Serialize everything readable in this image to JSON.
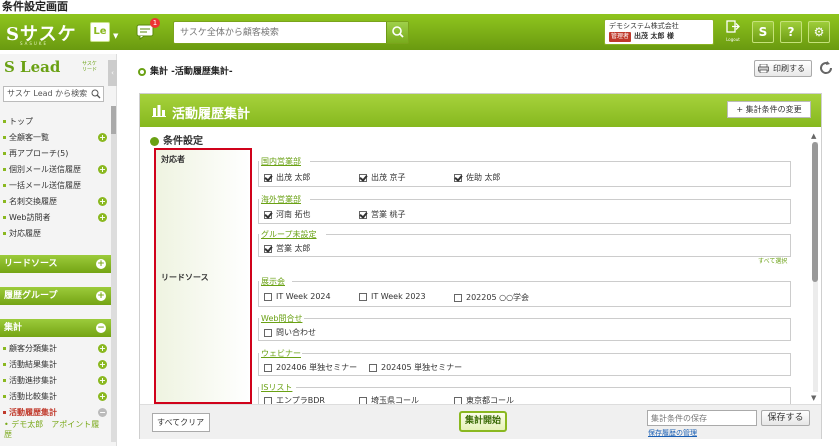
{
  "page_title": "条件設定画面",
  "header": {
    "logo": "Sサスケ",
    "logo_sub": "SASUKE",
    "le_badge": "Le",
    "notification_count": "1",
    "search_placeholder": "サスケ全体から顧客検索",
    "company": "デモシステム株式会社",
    "admin_badge": "管理者",
    "user_name": "出茂 太郎 様",
    "logout_label": "Logout",
    "btn_s": "S",
    "btn_help": "?",
    "btn_gear": "⚙"
  },
  "sidebar": {
    "logo": "S Lead",
    "logo_sub_1": "サスケ",
    "logo_sub_2": "リード",
    "search_placeholder": "サスケ Lead から検索",
    "items_top": [
      {
        "label": "トップ",
        "plus": false
      },
      {
        "label": "全顧客一覧",
        "plus": true
      },
      {
        "label": "再アプローチ(5)",
        "plus": false
      },
      {
        "label": "個別メール送信履歴",
        "plus": true
      },
      {
        "label": "一括メール送信履歴",
        "plus": false
      },
      {
        "label": "名刺交換履歴",
        "plus": true
      },
      {
        "label": "Web訪問者",
        "plus": true
      },
      {
        "label": "対応履歴",
        "plus": false
      }
    ],
    "section_lead_source": "リードソース",
    "section_history_group": "履歴グループ",
    "section_aggregate": "集計",
    "items_aggregate": [
      {
        "label": "顧客分類集計"
      },
      {
        "label": "活動結果集計"
      },
      {
        "label": "活動進捗集計"
      },
      {
        "label": "活動比較集計"
      },
      {
        "label": "活動履歴集計"
      }
    ],
    "sub_item": "デモ太郎　アポイント履歴"
  },
  "main": {
    "breadcrumb": "集計 -活動履歴集計-",
    "print_label": "印刷する",
    "panel_title": "活動履歴集計",
    "change_condition": "+ 集計条件の変更",
    "condition_heading": "条件設定",
    "label_responder": "対応者",
    "label_lead_source": "リードソース",
    "groups_responder": [
      {
        "name": "国内営業部",
        "members": [
          {
            "label": "出茂 太郎",
            "checked": true
          },
          {
            "label": "出茂 京子",
            "checked": true
          },
          {
            "label": "佐助 太郎",
            "checked": true
          }
        ]
      },
      {
        "name": "海外営業部",
        "members": [
          {
            "label": "河南 拓也",
            "checked": true
          },
          {
            "label": "営業 桃子",
            "checked": true
          }
        ]
      },
      {
        "name": "グループ未設定",
        "members": [
          {
            "label": "営業 太郎",
            "checked": true
          }
        ]
      }
    ],
    "select_all": "すべて選択",
    "groups_source": [
      {
        "name": "展示会",
        "members": [
          {
            "label": "IT Week 2024",
            "checked": false
          },
          {
            "label": "IT Week 2023",
            "checked": false
          },
          {
            "label": "202205 ○○学会",
            "checked": false
          }
        ]
      },
      {
        "name": "Web問合せ",
        "members": [
          {
            "label": "問い合わせ",
            "checked": false
          }
        ]
      },
      {
        "name": "ウェビナー",
        "members": [
          {
            "label": "202406 単独セミナー",
            "checked": false
          },
          {
            "label": "202405 単独セミナー",
            "checked": false
          }
        ]
      },
      {
        "name": "ISリスト",
        "members": [
          {
            "label": "エンプラBDR",
            "checked": false
          },
          {
            "label": "埼玉県コール",
            "checked": false
          },
          {
            "label": "東京都コール",
            "checked": false
          }
        ]
      }
    ],
    "footer": {
      "clear_label": "すべてクリア",
      "start_label": "集計開始",
      "save_placeholder": "集計条件の保存",
      "save_label": "保存する",
      "history_link": "保存履歴の管理"
    }
  },
  "colors": {
    "brand_green": "#86b81e",
    "highlight_red": "#d0021b"
  }
}
